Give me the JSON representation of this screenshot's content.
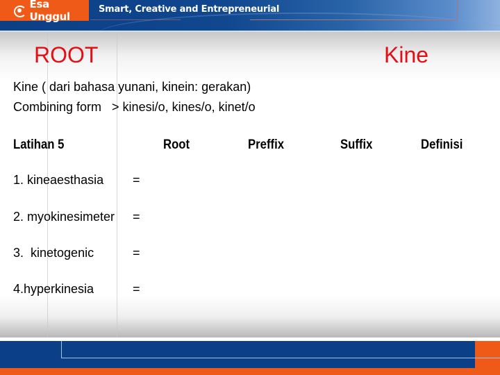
{
  "header": {
    "logo_text": "Esa Unggul",
    "tagline": "Smart, Creative and Entrepreneurial",
    "brand_colors": {
      "orange": "#f05a19",
      "blue": "#0b3f88"
    }
  },
  "slide": {
    "title_left": "ROOT",
    "title_right": "Kine",
    "title_color": "#e30f17",
    "lines": [
      "Kine ( dari bahasa yunani, kinein: gerakan)",
      "Combining form   > kinesi/o, kines/o, kinet/o"
    ],
    "table_headers": {
      "exercise": "Latihan 5",
      "root": "Root",
      "prefix": "Preffix",
      "suffix": "Suffix",
      "definition": "Definisi"
    },
    "items": [
      {
        "label": "1. kineaesthasia",
        "eq": "="
      },
      {
        "label": "2. myokinesimeter",
        "eq": "="
      },
      {
        "label": "3.  kinetogenic",
        "eq": "="
      },
      {
        "label": "4.hyperkinesia",
        "eq": "="
      }
    ]
  }
}
